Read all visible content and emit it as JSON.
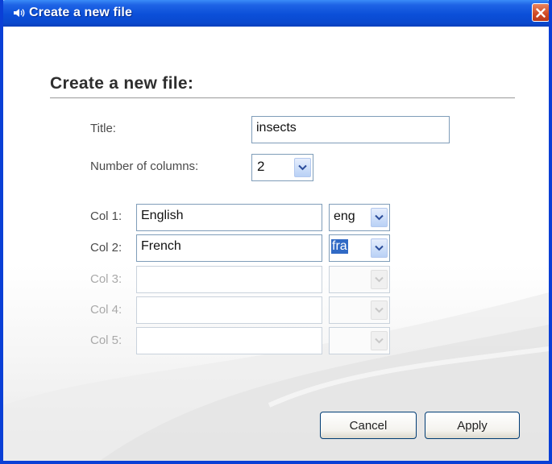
{
  "window": {
    "title": "Create a new file",
    "title_icon": "speaker-icon",
    "close_icon": "close-icon",
    "accent": "#0a49cf"
  },
  "form": {
    "heading": "Create a new file:",
    "title_label": "Title:",
    "title_value": "insects",
    "columns_label": "Number of columns:",
    "columns_value": "2",
    "columns": [
      {
        "label": "Col 1:",
        "name": "English",
        "lang": "eng",
        "enabled": true,
        "lang_selected": false
      },
      {
        "label": "Col 2:",
        "name": "French",
        "lang": "fra",
        "enabled": true,
        "lang_selected": true
      },
      {
        "label": "Col 3:",
        "name": "",
        "lang": "",
        "enabled": false,
        "lang_selected": false
      },
      {
        "label": "Col 4:",
        "name": "",
        "lang": "",
        "enabled": false,
        "lang_selected": false
      },
      {
        "label": "Col 5:",
        "name": "",
        "lang": "",
        "enabled": false,
        "lang_selected": false
      }
    ]
  },
  "buttons": {
    "cancel": "Cancel",
    "apply": "Apply"
  }
}
